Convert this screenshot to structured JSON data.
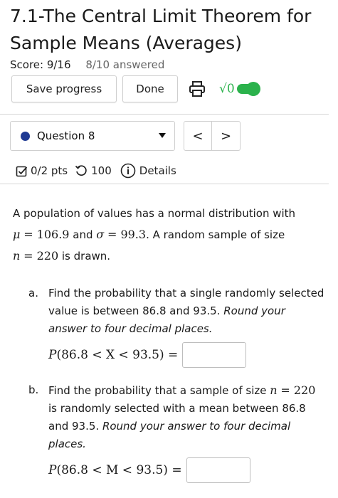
{
  "header": {
    "title": "7.1-The Central Limit Theorem for Sample Means (Averages)",
    "score": "Score: 9/16",
    "answered": "8/10 answered"
  },
  "toolbar": {
    "save_label": "Save progress",
    "done_label": "Done",
    "sqrt_label": "√0"
  },
  "question_nav": {
    "selected": "Question 8",
    "prev": "<",
    "next": ">"
  },
  "meta": {
    "points": "0/2 pts",
    "attempts": "100",
    "details": "Details"
  },
  "problem": {
    "intro_1": "A population of values has a normal distribution with",
    "mu_sym": "μ",
    "mu_val": "= 106.9",
    "and": " and ",
    "sigma_sym": "σ",
    "sigma_val": "= 99.3",
    "intro_2": ". A random sample of size",
    "n_sym": "n",
    "n_val": "= 220",
    "intro_3": " is drawn."
  },
  "part_a": {
    "label": "a.",
    "text": "Find the probability that a single randomly selected value is between 86.8 and 93.5.",
    "note": "Round your answer to four decimal places.",
    "expr_P": "P",
    "expr_body": "(86.8 < X < 93.5) ="
  },
  "part_b": {
    "label": "b.",
    "text_1": "Find the probability that a sample of size",
    "n_sym": "n",
    "n_val": "= 220",
    "text_2": " is randomly selected with a mean between 86.8 and 93.5.",
    "note": "Round your answer to four decimal places.",
    "expr_P": "P",
    "expr_body": "(86.8 < M < 93.5) ="
  },
  "colors": {
    "toggle": "#2bb24c",
    "question_dot": "#1f3a93"
  }
}
